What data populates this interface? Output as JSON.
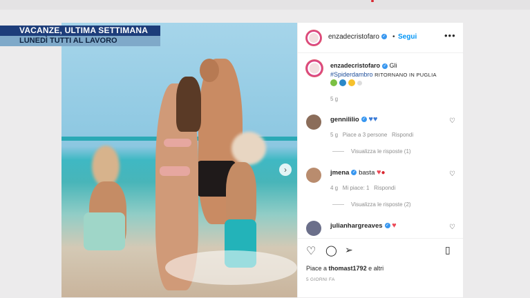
{
  "banner": {
    "line1": "VACANZE, ULTIMA SETTIMANA",
    "line2": "LUNEDÌ TUTTI AL LAVORO"
  },
  "post": {
    "username": "enzadecristofaro",
    "follow_label": "Segui",
    "more_icon": "more-horizontal-icon",
    "caption_word": "Gli",
    "hashtag": "#Spiderdambro",
    "caption_tail": "RITORNANO IN PUGLIA",
    "caption_age": "5 g",
    "next_icon": "chevron-right-icon"
  },
  "comments": [
    {
      "username": "gennililio",
      "age": "5 g",
      "likes": "Piace a 3 persone",
      "reply": "Rispondi",
      "view_replies": "Visualizza le risposte (1)"
    },
    {
      "username": "jmena",
      "text": "basta",
      "age": "4 g",
      "likes": "Mi piace: 1",
      "reply": "Rispondi",
      "view_replies": "Visualizza le risposte (2)"
    },
    {
      "username": "julianhargreaves"
    }
  ],
  "actions": {
    "liked_by_prefix": "Piace a",
    "liked_by_user": "thomast1792",
    "liked_by_suffix": "e altri",
    "posted": "5 GIORNI FA"
  },
  "colors": {
    "accent": "#0095f6",
    "banner_dark": "#1d3d7a",
    "banner_light": "#7fa9c9",
    "heart": "#ed4956"
  }
}
